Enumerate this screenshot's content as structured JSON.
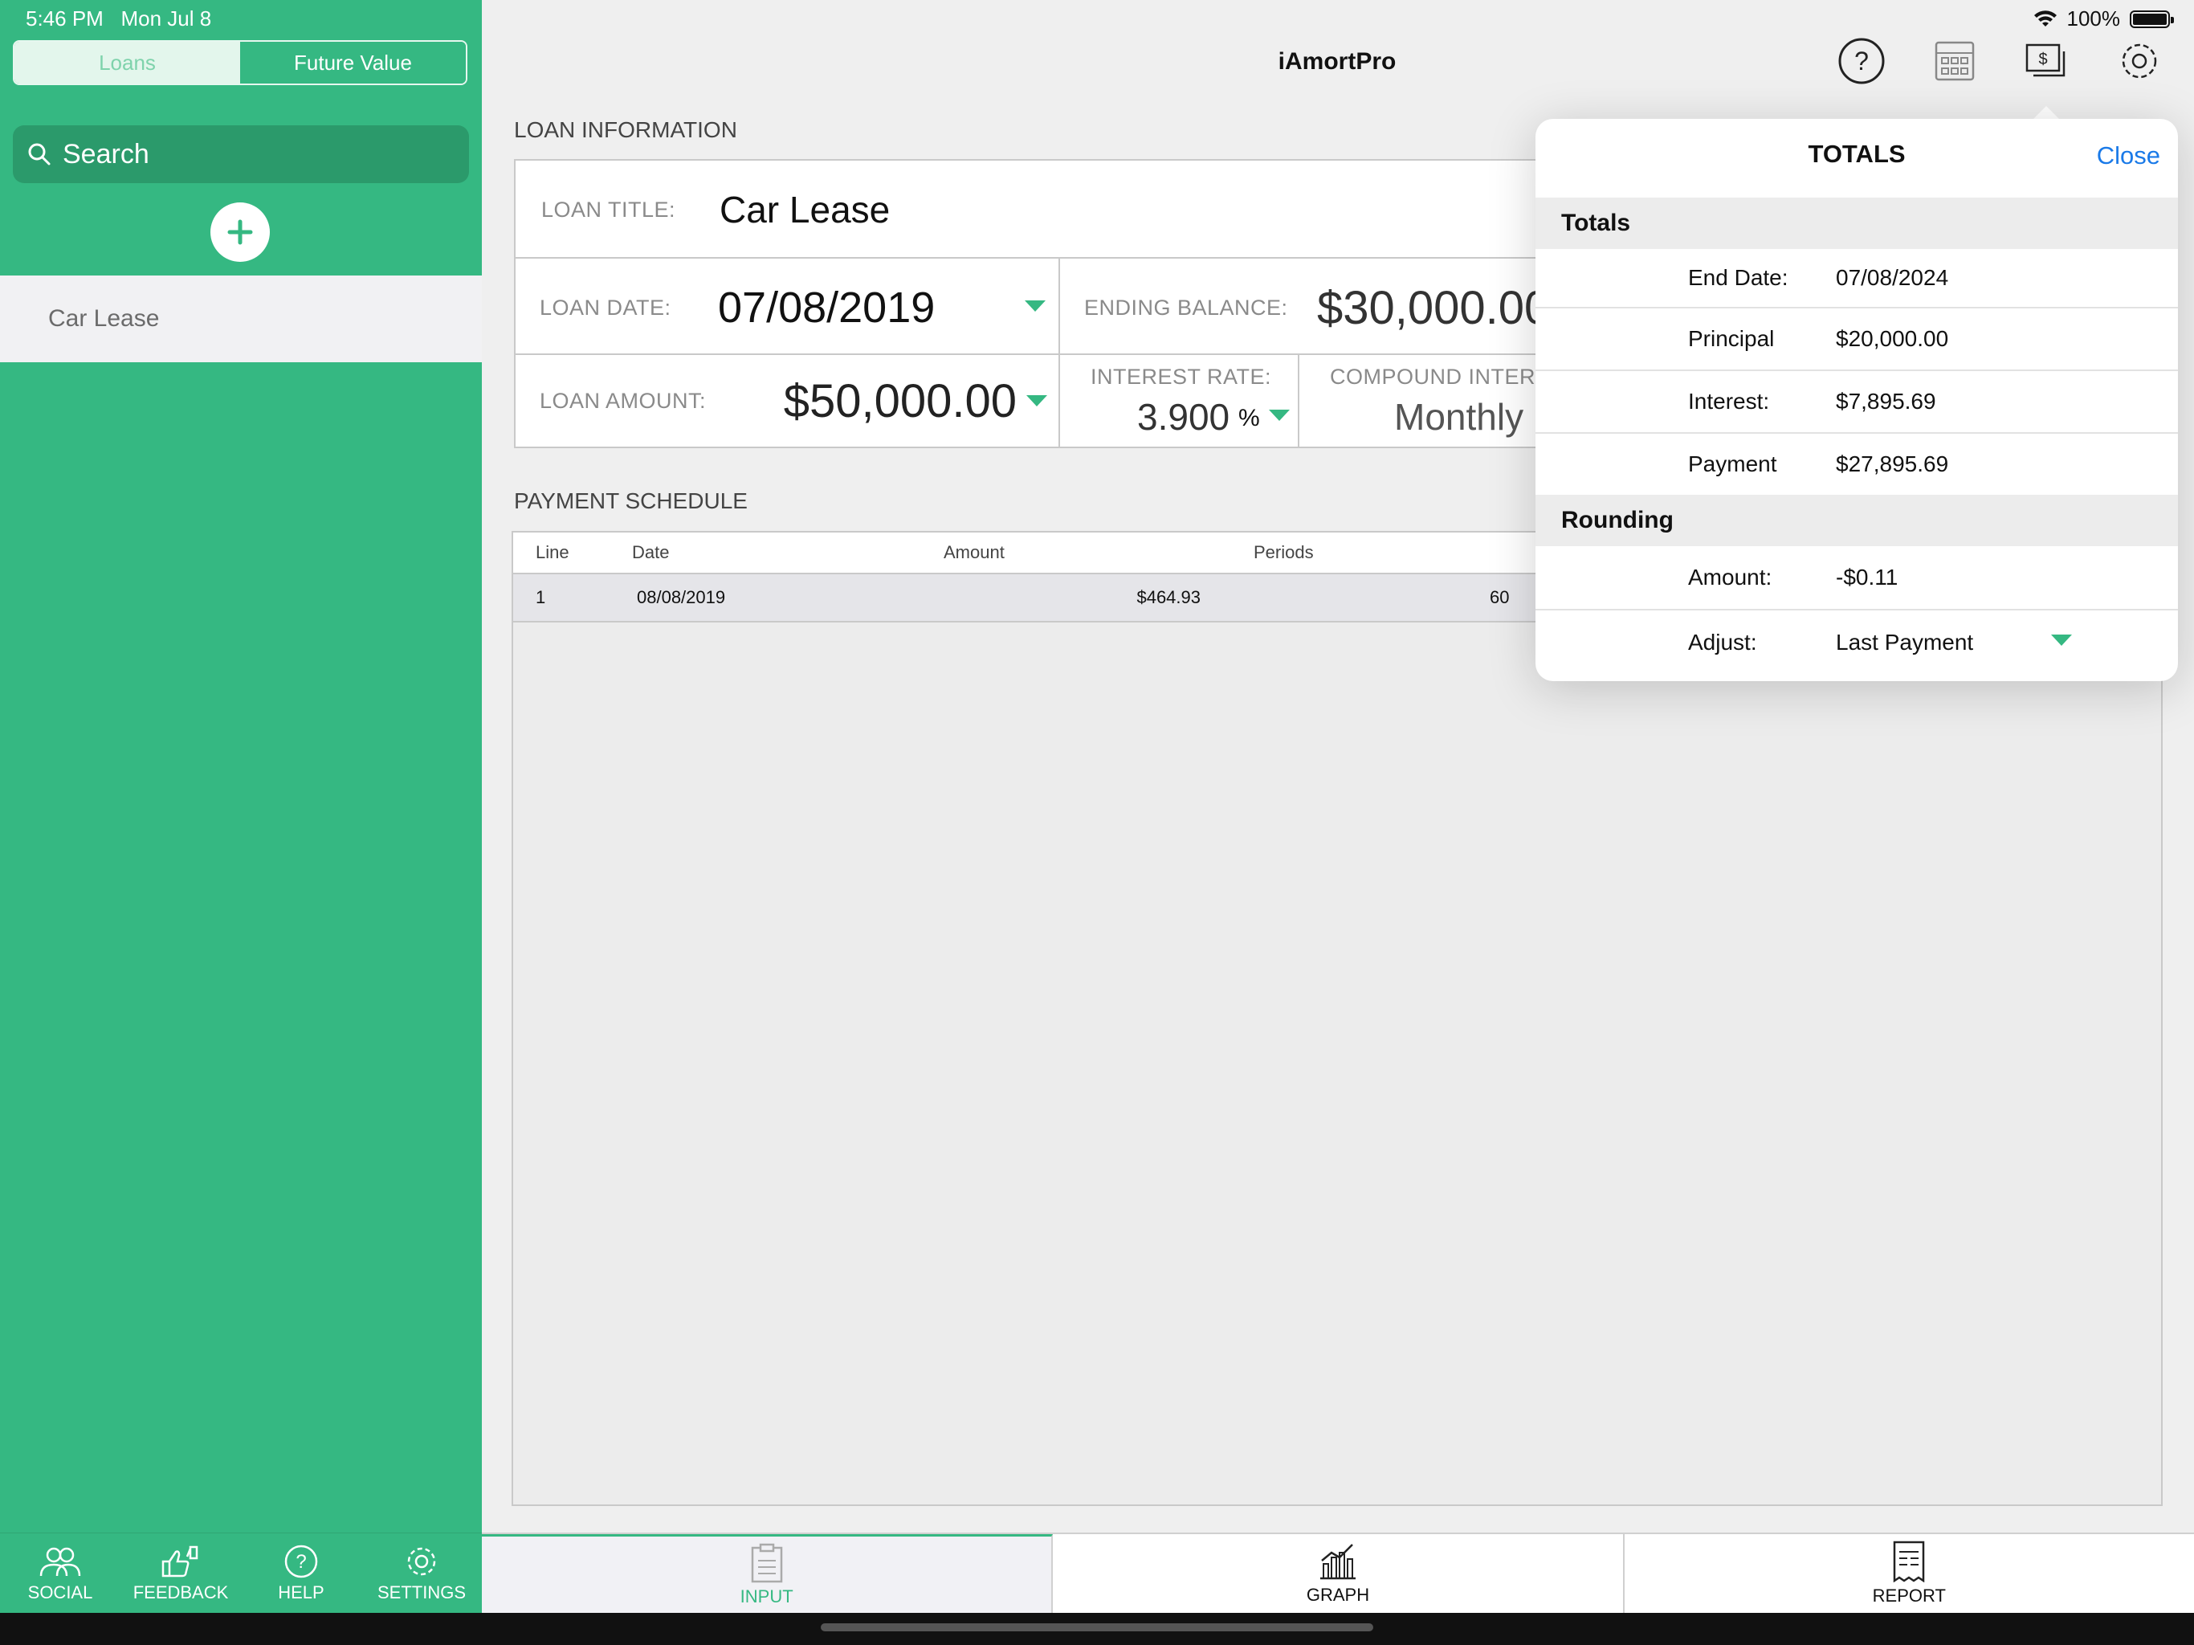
{
  "status_bar": {
    "time": "5:46 PM",
    "date": "Mon Jul 8",
    "battery": "100%"
  },
  "sidebar": {
    "segments": [
      "Loans",
      "Future Value"
    ],
    "search_placeholder": "Search",
    "loans": [
      "Car Lease"
    ],
    "tabs": [
      "SOCIAL",
      "FEEDBACK",
      "HELP",
      "SETTINGS"
    ]
  },
  "header": {
    "title": "iAmortPro"
  },
  "loan_info": {
    "section_label": "LOAN INFORMATION",
    "title_label": "LOAN TITLE:",
    "title_value": "Car Lease",
    "date_label": "LOAN DATE:",
    "date_value": "07/08/2019",
    "ending_balance_label": "ENDING BALANCE:",
    "ending_balance_value": "$30,000.00",
    "amount_label": "LOAN AMOUNT:",
    "amount_value": "$50,000.00",
    "rate_label": "INTEREST RATE:",
    "rate_value": "3.900",
    "rate_unit": "%",
    "compound_label": "COMPOUND INTEREST",
    "compound_value": "Monthly"
  },
  "schedule": {
    "section_label": "PAYMENT SCHEDULE",
    "columns": [
      "Line",
      "Date",
      "Amount",
      "Periods"
    ],
    "rows": [
      {
        "line": "1",
        "date": "08/08/2019",
        "amount": "$464.93",
        "periods": "60"
      }
    ]
  },
  "main_tabs": [
    "INPUT",
    "GRAPH",
    "REPORT"
  ],
  "totals_popover": {
    "title": "TOTALS",
    "close_label": "Close",
    "totals_header": "Totals",
    "totals": [
      {
        "key": "End Date:",
        "value": "07/08/2024"
      },
      {
        "key": "Principal",
        "value": "$20,000.00"
      },
      {
        "key": "Interest:",
        "value": "$7,895.69"
      },
      {
        "key": "Payment",
        "value": "$27,895.69"
      }
    ],
    "rounding_header": "Rounding",
    "rounding_amount_label": "Amount:",
    "rounding_amount_value": "-$0.11",
    "adjust_label": "Adjust:",
    "adjust_value": "Last Payment"
  },
  "colors": {
    "accent": "#35b882",
    "link": "#1a7ae8"
  }
}
